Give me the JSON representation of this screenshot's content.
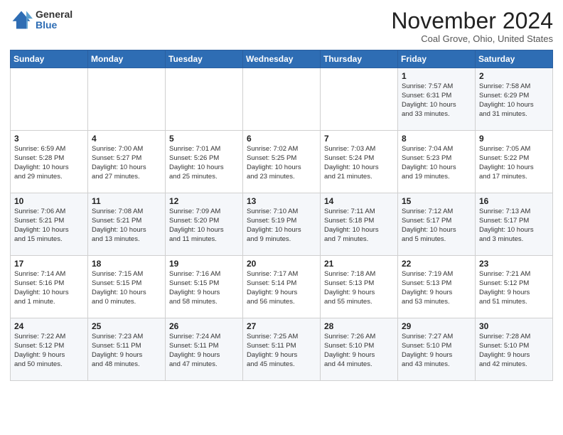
{
  "logo": {
    "general": "General",
    "blue": "Blue"
  },
  "header": {
    "month": "November 2024",
    "location": "Coal Grove, Ohio, United States"
  },
  "weekdays": [
    "Sunday",
    "Monday",
    "Tuesday",
    "Wednesday",
    "Thursday",
    "Friday",
    "Saturday"
  ],
  "weeks": [
    [
      {
        "day": "",
        "info": ""
      },
      {
        "day": "",
        "info": ""
      },
      {
        "day": "",
        "info": ""
      },
      {
        "day": "",
        "info": ""
      },
      {
        "day": "",
        "info": ""
      },
      {
        "day": "1",
        "info": "Sunrise: 7:57 AM\nSunset: 6:31 PM\nDaylight: 10 hours\nand 33 minutes."
      },
      {
        "day": "2",
        "info": "Sunrise: 7:58 AM\nSunset: 6:29 PM\nDaylight: 10 hours\nand 31 minutes."
      }
    ],
    [
      {
        "day": "3",
        "info": "Sunrise: 6:59 AM\nSunset: 5:28 PM\nDaylight: 10 hours\nand 29 minutes."
      },
      {
        "day": "4",
        "info": "Sunrise: 7:00 AM\nSunset: 5:27 PM\nDaylight: 10 hours\nand 27 minutes."
      },
      {
        "day": "5",
        "info": "Sunrise: 7:01 AM\nSunset: 5:26 PM\nDaylight: 10 hours\nand 25 minutes."
      },
      {
        "day": "6",
        "info": "Sunrise: 7:02 AM\nSunset: 5:25 PM\nDaylight: 10 hours\nand 23 minutes."
      },
      {
        "day": "7",
        "info": "Sunrise: 7:03 AM\nSunset: 5:24 PM\nDaylight: 10 hours\nand 21 minutes."
      },
      {
        "day": "8",
        "info": "Sunrise: 7:04 AM\nSunset: 5:23 PM\nDaylight: 10 hours\nand 19 minutes."
      },
      {
        "day": "9",
        "info": "Sunrise: 7:05 AM\nSunset: 5:22 PM\nDaylight: 10 hours\nand 17 minutes."
      }
    ],
    [
      {
        "day": "10",
        "info": "Sunrise: 7:06 AM\nSunset: 5:21 PM\nDaylight: 10 hours\nand 15 minutes."
      },
      {
        "day": "11",
        "info": "Sunrise: 7:08 AM\nSunset: 5:21 PM\nDaylight: 10 hours\nand 13 minutes."
      },
      {
        "day": "12",
        "info": "Sunrise: 7:09 AM\nSunset: 5:20 PM\nDaylight: 10 hours\nand 11 minutes."
      },
      {
        "day": "13",
        "info": "Sunrise: 7:10 AM\nSunset: 5:19 PM\nDaylight: 10 hours\nand 9 minutes."
      },
      {
        "day": "14",
        "info": "Sunrise: 7:11 AM\nSunset: 5:18 PM\nDaylight: 10 hours\nand 7 minutes."
      },
      {
        "day": "15",
        "info": "Sunrise: 7:12 AM\nSunset: 5:17 PM\nDaylight: 10 hours\nand 5 minutes."
      },
      {
        "day": "16",
        "info": "Sunrise: 7:13 AM\nSunset: 5:17 PM\nDaylight: 10 hours\nand 3 minutes."
      }
    ],
    [
      {
        "day": "17",
        "info": "Sunrise: 7:14 AM\nSunset: 5:16 PM\nDaylight: 10 hours\nand 1 minute."
      },
      {
        "day": "18",
        "info": "Sunrise: 7:15 AM\nSunset: 5:15 PM\nDaylight: 10 hours\nand 0 minutes."
      },
      {
        "day": "19",
        "info": "Sunrise: 7:16 AM\nSunset: 5:15 PM\nDaylight: 9 hours\nand 58 minutes."
      },
      {
        "day": "20",
        "info": "Sunrise: 7:17 AM\nSunset: 5:14 PM\nDaylight: 9 hours\nand 56 minutes."
      },
      {
        "day": "21",
        "info": "Sunrise: 7:18 AM\nSunset: 5:13 PM\nDaylight: 9 hours\nand 55 minutes."
      },
      {
        "day": "22",
        "info": "Sunrise: 7:19 AM\nSunset: 5:13 PM\nDaylight: 9 hours\nand 53 minutes."
      },
      {
        "day": "23",
        "info": "Sunrise: 7:21 AM\nSunset: 5:12 PM\nDaylight: 9 hours\nand 51 minutes."
      }
    ],
    [
      {
        "day": "24",
        "info": "Sunrise: 7:22 AM\nSunset: 5:12 PM\nDaylight: 9 hours\nand 50 minutes."
      },
      {
        "day": "25",
        "info": "Sunrise: 7:23 AM\nSunset: 5:11 PM\nDaylight: 9 hours\nand 48 minutes."
      },
      {
        "day": "26",
        "info": "Sunrise: 7:24 AM\nSunset: 5:11 PM\nDaylight: 9 hours\nand 47 minutes."
      },
      {
        "day": "27",
        "info": "Sunrise: 7:25 AM\nSunset: 5:11 PM\nDaylight: 9 hours\nand 45 minutes."
      },
      {
        "day": "28",
        "info": "Sunrise: 7:26 AM\nSunset: 5:10 PM\nDaylight: 9 hours\nand 44 minutes."
      },
      {
        "day": "29",
        "info": "Sunrise: 7:27 AM\nSunset: 5:10 PM\nDaylight: 9 hours\nand 43 minutes."
      },
      {
        "day": "30",
        "info": "Sunrise: 7:28 AM\nSunset: 5:10 PM\nDaylight: 9 hours\nand 42 minutes."
      }
    ]
  ]
}
